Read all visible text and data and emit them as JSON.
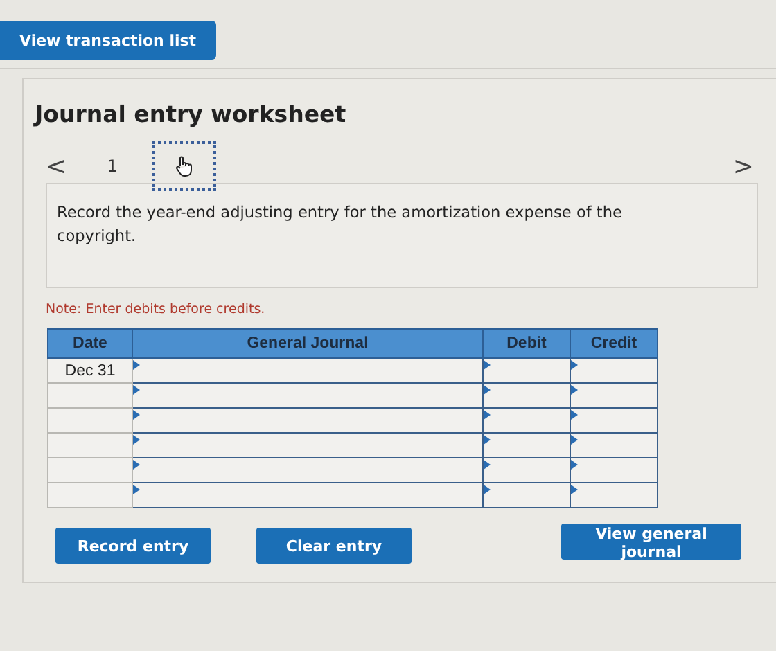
{
  "top_button": "View transaction list",
  "worksheet": {
    "title": "Journal entry worksheet",
    "pager": {
      "prev": "<",
      "next": ">",
      "pages": [
        {
          "kind": "number",
          "label": "1",
          "selected": false
        },
        {
          "kind": "cursor",
          "selected": true
        }
      ]
    },
    "prompt": "Record the year-end adjusting entry for the amortization expense of the copyright.",
    "note": "Note: Enter debits before credits.",
    "table": {
      "columns": [
        "Date",
        "General Journal",
        "Debit",
        "Credit"
      ],
      "rows": [
        {
          "date": "Dec 31"
        },
        {},
        {},
        {},
        {},
        {}
      ]
    },
    "buttons": [
      "Record entry",
      "Clear entry",
      "View general journal"
    ]
  }
}
